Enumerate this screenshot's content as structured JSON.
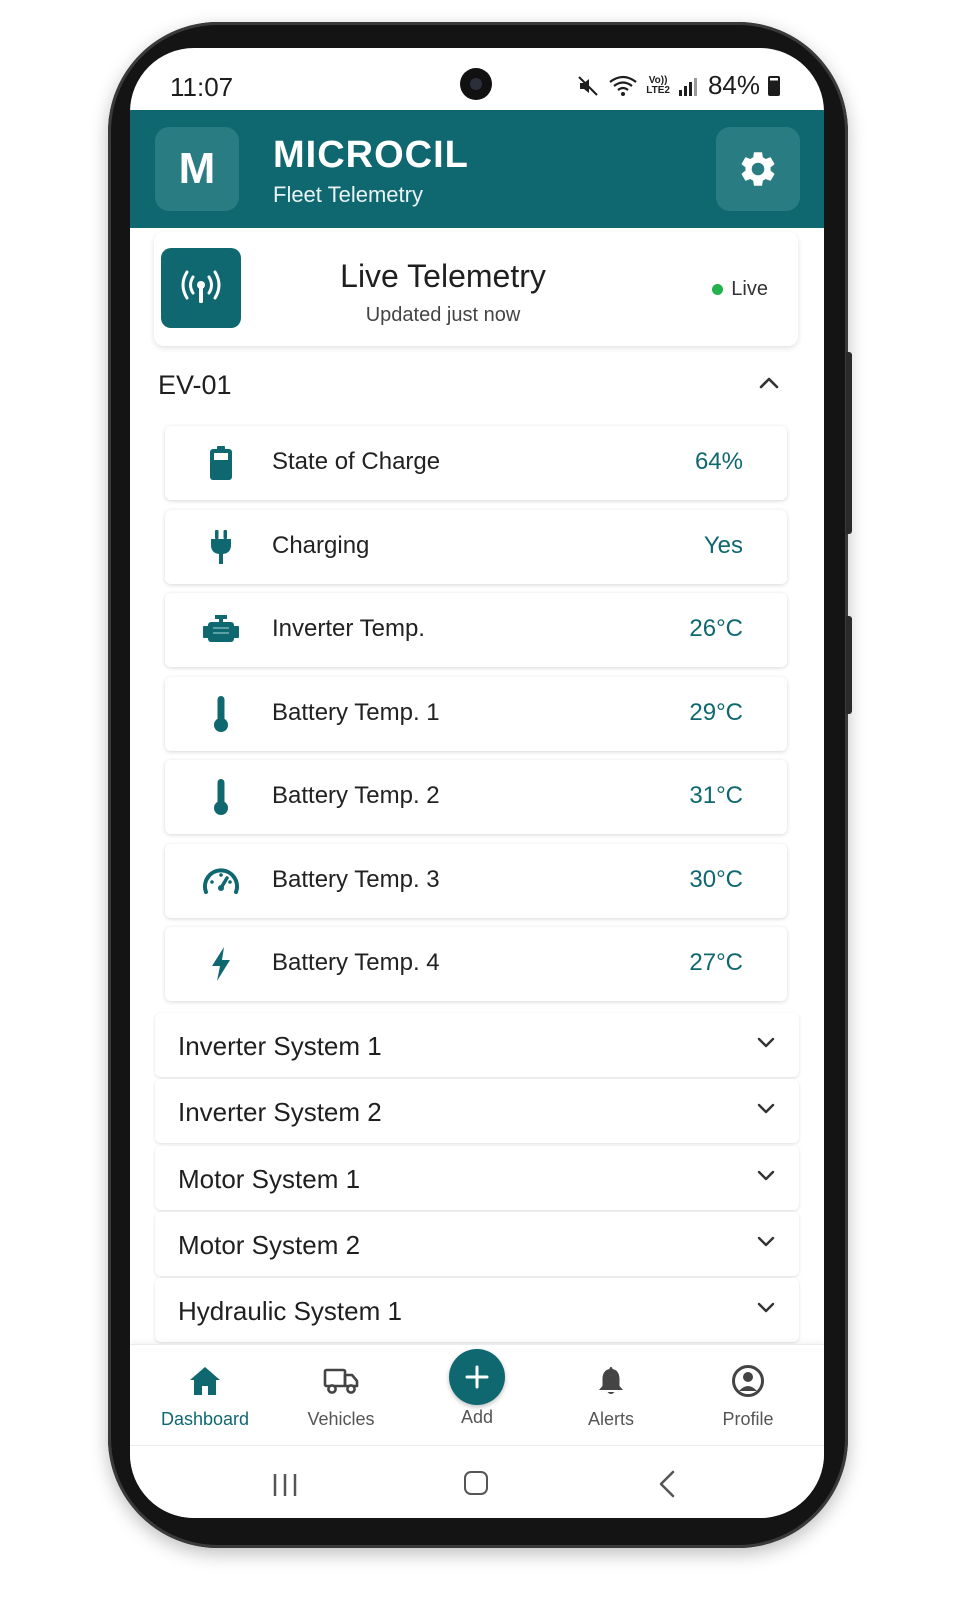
{
  "status_bar": {
    "time": "11:07",
    "network_label": "Vo))\nLTE2",
    "battery": "84%"
  },
  "header": {
    "logo_letter": "M",
    "brand": "MICROCIL",
    "subtitle": "Fleet Telemetry",
    "settings_icon": "gear-icon",
    "background_color": "#0f6870"
  },
  "live_card": {
    "title": "Live Telemetry",
    "subtitle": "Updated just now",
    "status_label": "Live",
    "status_color": "#22b14c",
    "icon": "antenna-icon"
  },
  "vehicle": {
    "name": "EV-01",
    "expanded": true,
    "metrics": [
      {
        "icon": "battery-icon",
        "label": "State of Charge",
        "value": "64%"
      },
      {
        "icon": "plug-icon",
        "label": "Charging",
        "value": "Yes"
      },
      {
        "icon": "engine-icon",
        "label": "Inverter Temp.",
        "value": "26°C"
      },
      {
        "icon": "thermometer-icon",
        "label": "Battery Temp. 1",
        "value": "29°C"
      },
      {
        "icon": "thermometer-icon",
        "label": "Battery Temp. 2",
        "value": "31°C"
      },
      {
        "icon": "gauge-icon",
        "label": "Battery Temp. 3",
        "value": "30°C"
      },
      {
        "icon": "lightning-icon",
        "label": "Battery Temp. 4",
        "value": "27°C"
      }
    ]
  },
  "systems": [
    {
      "label": "Inverter System 1"
    },
    {
      "label": "Inverter System 2"
    },
    {
      "label": "Motor System 1"
    },
    {
      "label": "Motor System 2"
    },
    {
      "label": "Hydraulic System 1"
    }
  ],
  "bottom_nav": {
    "dashboard": "Dashboard",
    "vehicles": "Vehicles",
    "add": "Add",
    "alerts": "Alerts",
    "profile": "Profile",
    "active": "Dashboard",
    "accent_color": "#0f6870"
  }
}
